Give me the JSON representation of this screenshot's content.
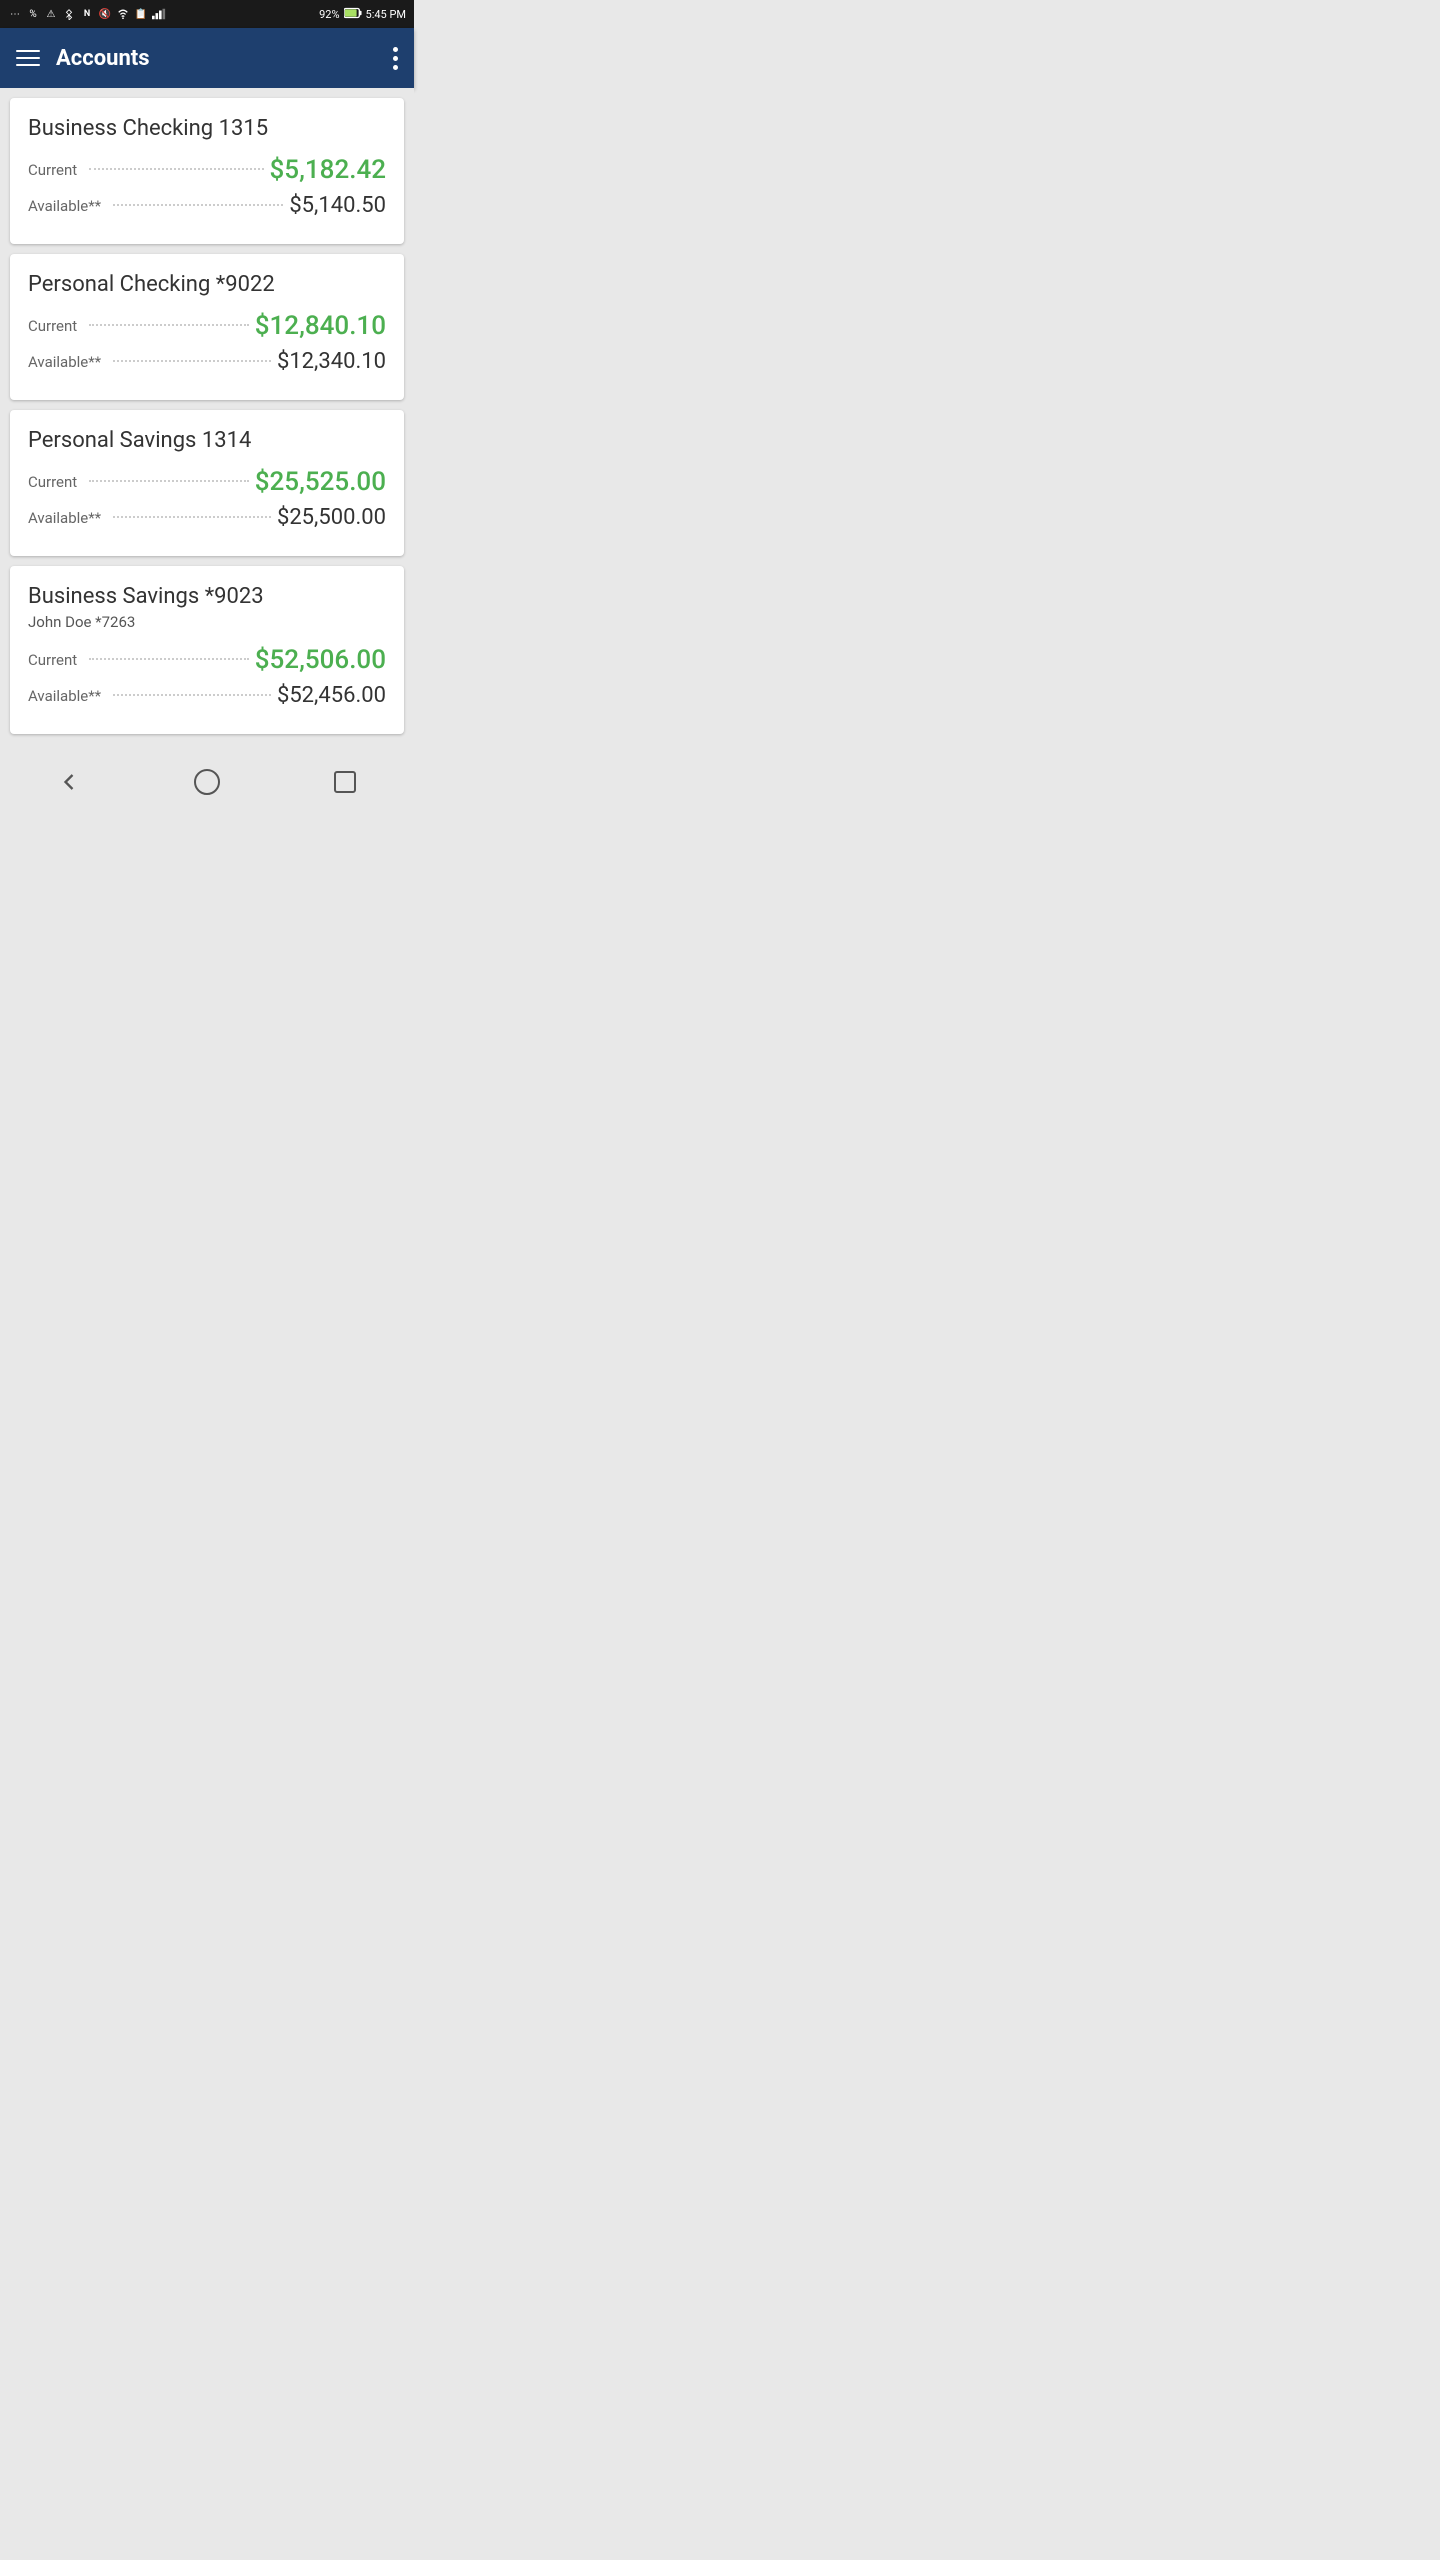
{
  "statusBar": {
    "time": "5:45 PM",
    "battery": "92%",
    "icons": [
      "...",
      "%",
      "⚠",
      "BT",
      "NFC",
      "mute",
      "wifi",
      "file",
      "signal"
    ]
  },
  "header": {
    "title": "Accounts",
    "menuLabel": "menu",
    "moreLabel": "more options"
  },
  "accounts": [
    {
      "id": "account-1",
      "name": "Business Checking 1315",
      "subtitle": null,
      "current": "$5,182.42",
      "available": "$5,140.50"
    },
    {
      "id": "account-2",
      "name": "Personal Checking *9022",
      "subtitle": null,
      "current": "$12,840.10",
      "available": "$12,340.10"
    },
    {
      "id": "account-3",
      "name": "Personal Savings 1314",
      "subtitle": null,
      "current": "$25,525.00",
      "available": "$25,500.00"
    },
    {
      "id": "account-4",
      "name": "Business Savings *9023",
      "subtitle": "John Doe *7263",
      "current": "$52,506.00",
      "available": "$52,456.00"
    }
  ],
  "labels": {
    "current": "Current",
    "available": "Available**"
  }
}
